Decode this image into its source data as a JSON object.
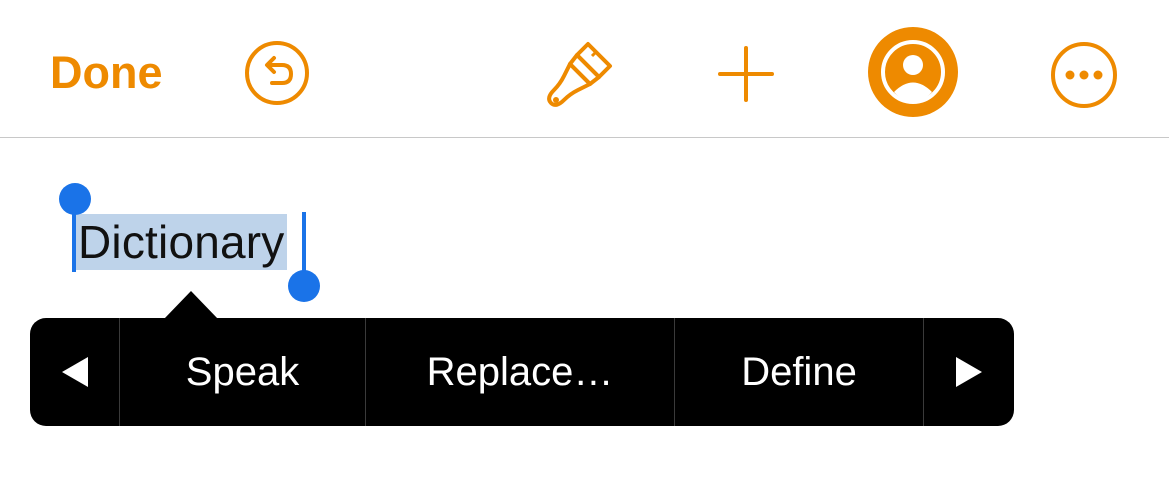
{
  "toolbar": {
    "done_label": "Done",
    "accent_color": "#ee8a00",
    "icons": [
      "undo-icon",
      "paintbrush-icon",
      "plus-icon",
      "collaborate-icon",
      "more-icon"
    ]
  },
  "document": {
    "selected_word": "Dictionary",
    "selection_color": "#bed3ea",
    "handle_color": "#1a73e8"
  },
  "edit_menu": {
    "items": [
      {
        "label": "Speak"
      },
      {
        "label": "Replace…"
      },
      {
        "label": "Define"
      }
    ],
    "prev_icon": "triangle-left-icon",
    "next_icon": "triangle-right-icon"
  }
}
